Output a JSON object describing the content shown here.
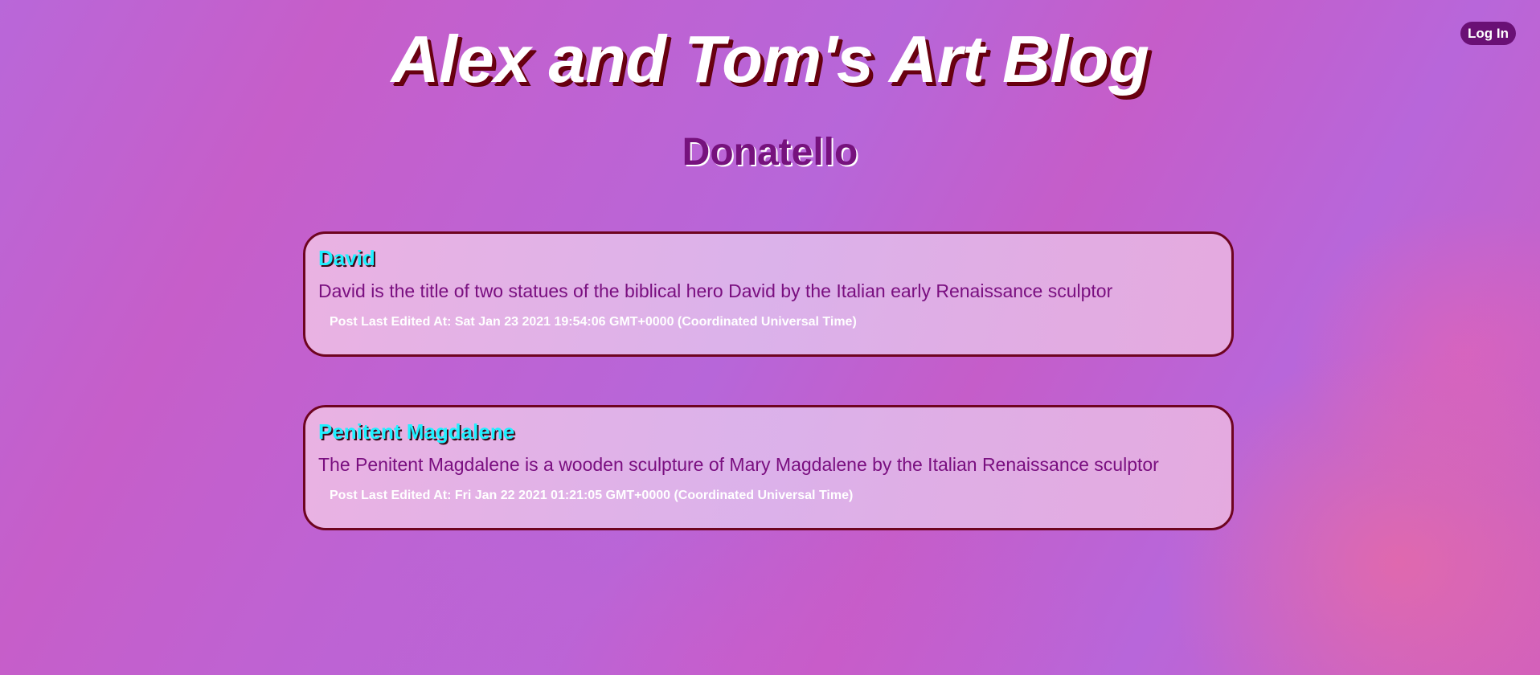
{
  "header": {
    "login_label": "Log In",
    "site_title": "Alex and Tom's Art Blog"
  },
  "page": {
    "title": "Donatello"
  },
  "posts": [
    {
      "title": "David",
      "body": "David is the title of two statues of the biblical hero David by the Italian early Renaissance sculptor",
      "meta": "Post Last Edited At: Sat Jan 23 2021 19:54:06 GMT+0000 (Coordinated Universal Time)"
    },
    {
      "title": "Penitent Magdalene",
      "body": "The Penitent Magdalene is a wooden sculpture of Mary Magdalene by the Italian Renaissance sculptor",
      "meta": "Post Last Edited At: Fri Jan 22 2021 01:21:05 GMT+0000 (Coordinated Universal Time)"
    }
  ],
  "colors": {
    "login_button_bg": "#6a1075",
    "page_title": "#76127d",
    "post_title": "#1ff0ff",
    "post_border": "#6e0420",
    "post_body": "#7a0f80"
  }
}
